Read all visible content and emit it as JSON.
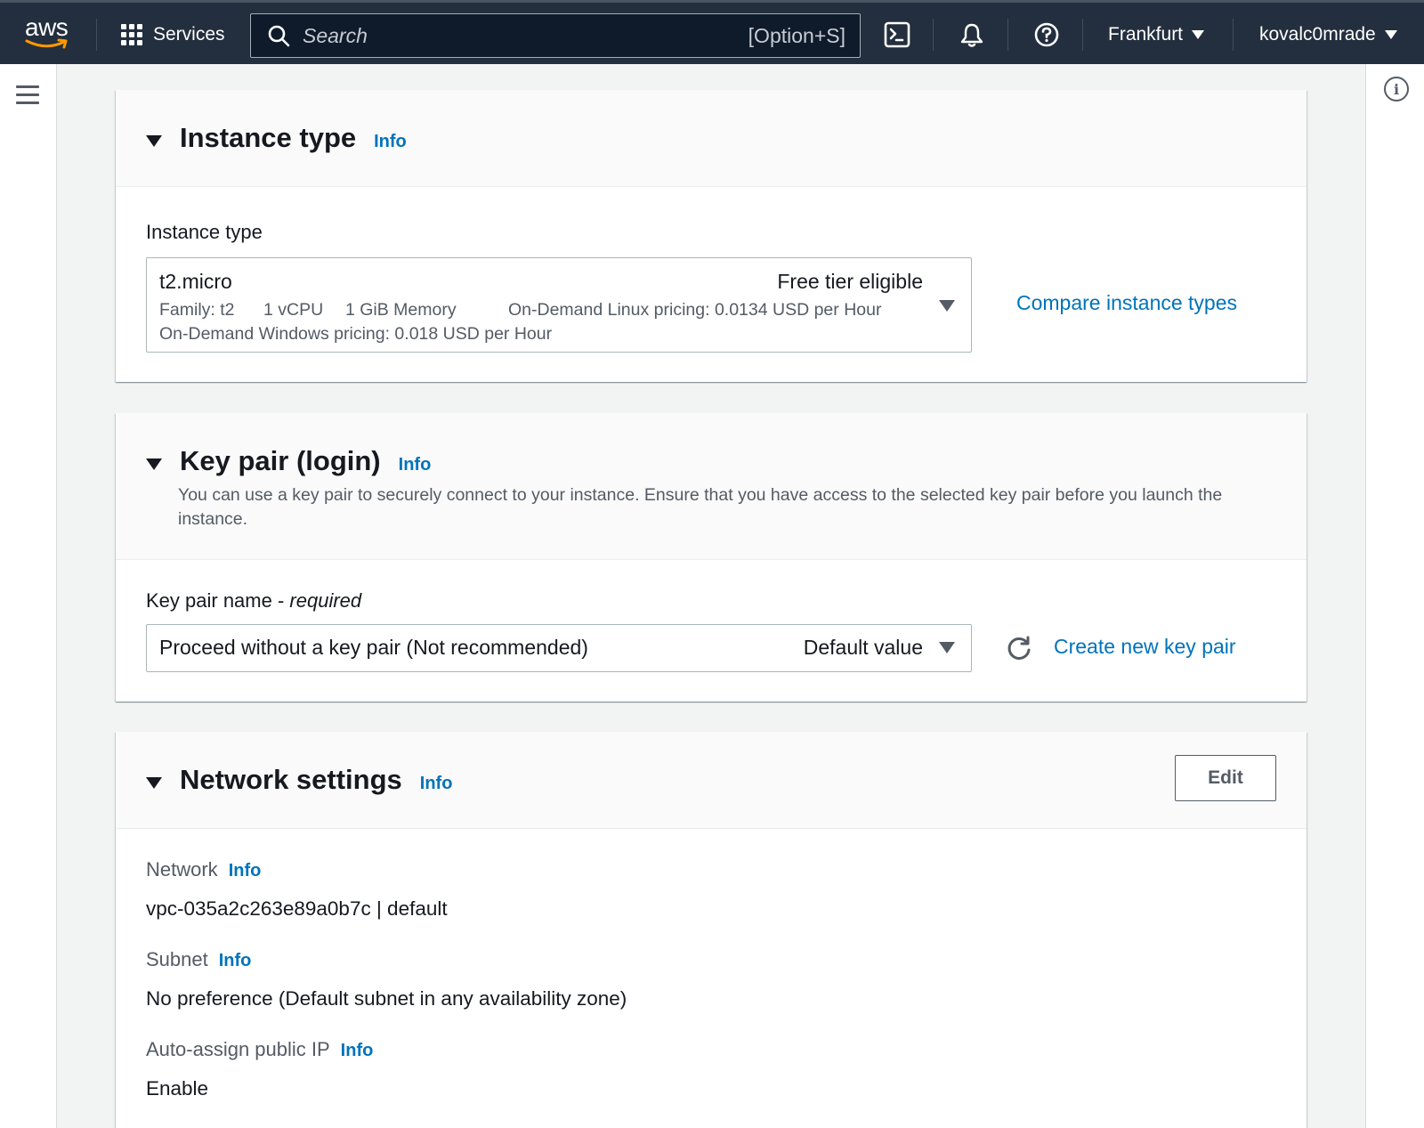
{
  "nav": {
    "logo_text": "aws",
    "services_label": "Services",
    "search_placeholder": "Search",
    "search_shortcut": "[Option+S]",
    "region": "Frankfurt",
    "user": "kovalc0mrade"
  },
  "instance_type_section": {
    "title": "Instance type",
    "info": "Info",
    "field_label": "Instance type",
    "selected": {
      "name": "t2.micro",
      "badge": "Free tier eligible",
      "family": "Family: t2",
      "vcpu": "1 vCPU",
      "memory": "1 GiB Memory",
      "linux_pricing": "On-Demand Linux pricing: 0.0134 USD per Hour",
      "windows_pricing": "On-Demand Windows pricing: 0.018 USD per Hour"
    },
    "compare_link": "Compare instance types"
  },
  "key_pair_section": {
    "title": "Key pair (login)",
    "info": "Info",
    "description": "You can use a key pair to securely connect to your instance. Ensure that you have access to the selected key pair before you launch the instance.",
    "field_label": "Key pair name - ",
    "field_required": "required",
    "selected_value": "Proceed without a key pair (Not recommended)",
    "selected_tag": "Default value",
    "create_link": "Create new key pair"
  },
  "network_section": {
    "title": "Network settings",
    "info": "Info",
    "edit_button": "Edit",
    "network_label": "Network",
    "network_info": "Info",
    "network_value": "vpc-035a2c263e89a0b7c | default",
    "subnet_label": "Subnet",
    "subnet_info": "Info",
    "subnet_value": "No preference (Default subnet in any availability zone)",
    "public_ip_label": "Auto-assign public IP",
    "public_ip_info": "Info",
    "public_ip_value": "Enable"
  },
  "colors": {
    "nav_bg": "#232f3e",
    "link": "#0073bb",
    "text": "#16191f",
    "muted": "#545b64"
  }
}
